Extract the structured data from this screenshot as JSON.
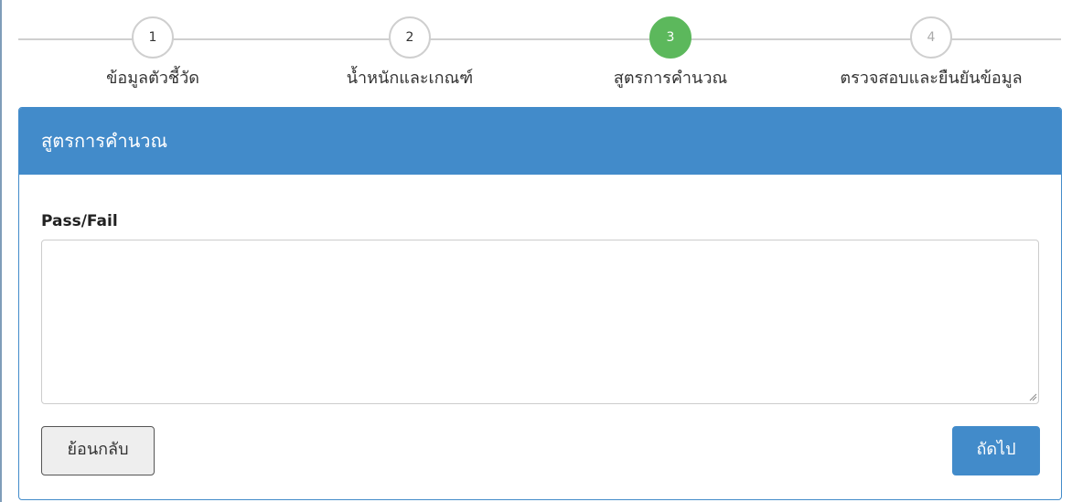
{
  "steps": [
    {
      "number": "1",
      "label": "ข้อมูลตัวชี้วัด",
      "state": "done"
    },
    {
      "number": "2",
      "label": "น้ำหนักและเกณฑ์",
      "state": "done"
    },
    {
      "number": "3",
      "label": "สูตรการคำนวณ",
      "state": "active"
    },
    {
      "number": "4",
      "label": "ตรวจสอบและยืนยันข้อมูล",
      "state": "todo"
    }
  ],
  "panel": {
    "title": "สูตรการคำนวณ",
    "field_label": "Pass/Fail",
    "field_value": "",
    "back_label": "ย้อนกลับ",
    "next_label": "ถัดไป"
  },
  "colors": {
    "primary": "#428bca",
    "active_step": "#5cb85c",
    "inactive_step_border": "#cfcfcf"
  }
}
